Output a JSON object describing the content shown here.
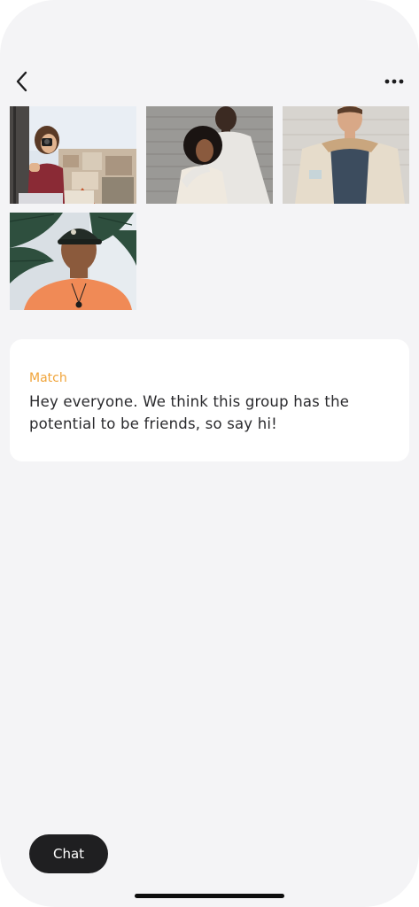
{
  "header": {
    "back_icon": "chevron-left-icon",
    "more_icon": "more-horizontal-icon"
  },
  "photos": [
    {
      "name": "photo-woman-camera",
      "description_icon": "photo"
    },
    {
      "name": "photo-couple",
      "description_icon": "photo"
    },
    {
      "name": "photo-man-jacket",
      "description_icon": "photo"
    },
    {
      "name": "photo-man-cap",
      "description_icon": "photo"
    }
  ],
  "message": {
    "sender": "Match",
    "text": "Hey everyone. We think this group has the potential to be friends, so say hi!"
  },
  "footer": {
    "chat_label": "Chat"
  },
  "colors": {
    "background": "#f4f4f6",
    "card": "#ffffff",
    "sender": "#f0a43a",
    "chat_button": "#1f1f21"
  }
}
